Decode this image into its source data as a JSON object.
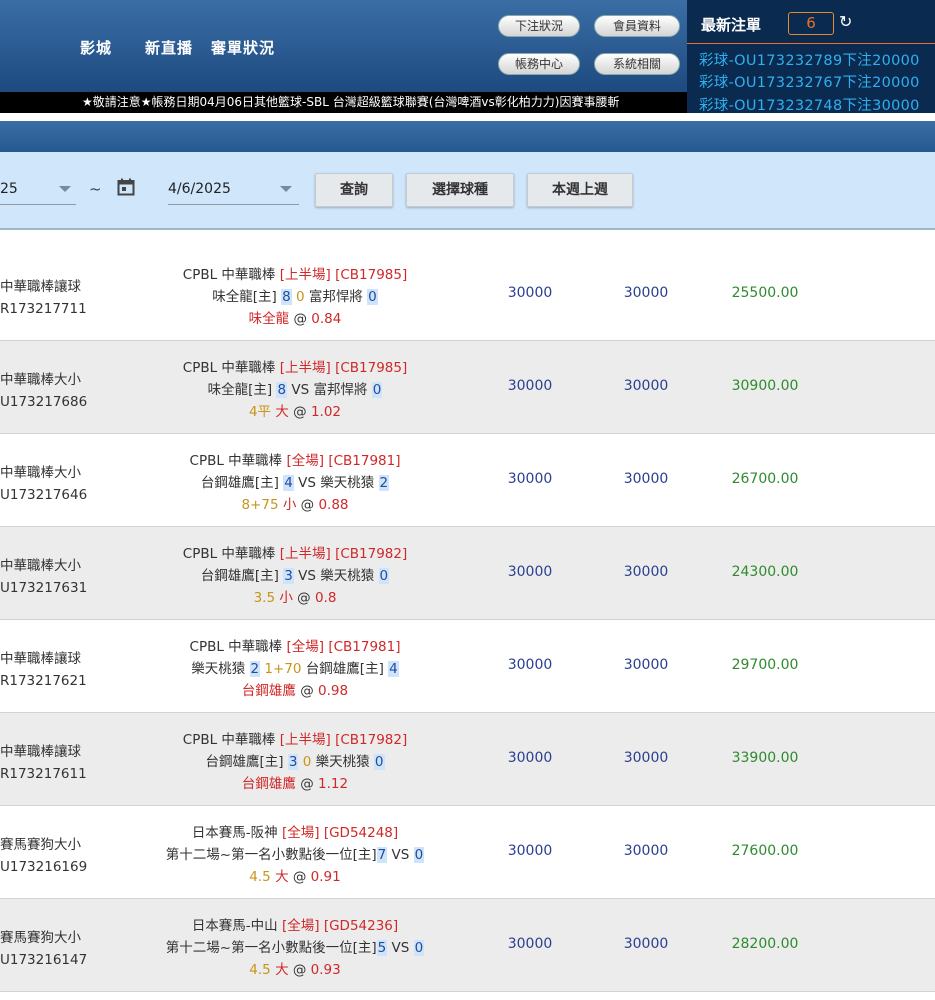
{
  "header": {
    "nav": [
      "影城",
      "新直播",
      "審單狀況"
    ],
    "top_buttons": [
      "下注狀況",
      "會員資料",
      "帳務中心",
      "系統相關"
    ],
    "latest": {
      "title": "最新注單",
      "count": "6",
      "items": [
        "彩球-OU173232789下注20000",
        "彩球-OU173232767下注20000",
        "彩球-OU173232748下注30000"
      ]
    },
    "marquee": "★敬請注意★帳務日期04月06日其他籃球-SBL  台灣超級籃球聯賽(台灣啤酒vs彰化柏力力)因賽事腰斬"
  },
  "filter": {
    "start_date": "25",
    "separator": "~",
    "end_date": "4/6/2025",
    "buttons": [
      "查詢",
      "選擇球種",
      "本週上週"
    ]
  },
  "rows": [
    {
      "cat": "中華職棒讓球",
      "id": "R173217711",
      "l1": {
        "league": "CPBL 中華職棒",
        "period": "[上半場]",
        "code": "[CB17985]"
      },
      "l2": {
        "a": "味全龍[主]",
        "sa": "8",
        "mid": "0",
        "b": "富邦悍將",
        "sb": "0"
      },
      "l3": {
        "pick": "味全龍",
        "at": "@",
        "odds": "0.84"
      },
      "amt1": "30000",
      "amt2": "30000",
      "win": "25500.00"
    },
    {
      "cat": "中華職棒大小",
      "id": "U173217686",
      "l1": {
        "league": "CPBL 中華職棒",
        "period": "[上半場]",
        "code": "[CB17985]"
      },
      "l2": {
        "a": "味全龍[主]",
        "sa": "8",
        "mid": "VS",
        "b": "富邦悍將",
        "sb": "0"
      },
      "l3": {
        "line": "4平",
        "pick": "大",
        "at": "@",
        "odds": "1.02"
      },
      "amt1": "30000",
      "amt2": "30000",
      "win": "30900.00"
    },
    {
      "cat": "中華職棒大小",
      "id": "U173217646",
      "l1": {
        "league": "CPBL 中華職棒",
        "period": "[全場]",
        "code": "[CB17981]"
      },
      "l2": {
        "a": "台鋼雄鷹[主]",
        "sa": "4",
        "mid": "VS",
        "b": "樂天桃猿",
        "sb": "2"
      },
      "l3": {
        "line": "8+75",
        "pick": "小",
        "at": "@",
        "odds": "0.88"
      },
      "amt1": "30000",
      "amt2": "30000",
      "win": "26700.00"
    },
    {
      "cat": "中華職棒大小",
      "id": "U173217631",
      "l1": {
        "league": "CPBL 中華職棒",
        "period": "[上半場]",
        "code": "[CB17982]"
      },
      "l2": {
        "a": "台鋼雄鷹[主]",
        "sa": "3",
        "mid": "VS",
        "b": "樂天桃猿",
        "sb": "0"
      },
      "l3": {
        "line": "3.5",
        "pick": "小",
        "at": "@",
        "odds": "0.8"
      },
      "amt1": "30000",
      "amt2": "30000",
      "win": "24300.00"
    },
    {
      "cat": "中華職棒讓球",
      "id": "R173217621",
      "l1": {
        "league": "CPBL 中華職棒",
        "period": "[全場]",
        "code": "[CB17981]"
      },
      "l2": {
        "a": "樂天桃猿",
        "sa": "2",
        "mid": "1+70",
        "b": "台鋼雄鷹[主]",
        "sb": "4"
      },
      "l3": {
        "pick": "台鋼雄鷹",
        "at": "@",
        "odds": "0.98"
      },
      "amt1": "30000",
      "amt2": "30000",
      "win": "29700.00"
    },
    {
      "cat": "中華職棒讓球",
      "id": "R173217611",
      "l1": {
        "league": "CPBL 中華職棒",
        "period": "[上半場]",
        "code": "[CB17982]"
      },
      "l2": {
        "a": "台鋼雄鷹[主]",
        "sa": "3",
        "mid": "0",
        "b": "樂天桃猿",
        "sb": "0"
      },
      "l3": {
        "pick": "台鋼雄鷹",
        "at": "@",
        "odds": "1.12"
      },
      "amt1": "30000",
      "amt2": "30000",
      "win": "33900.00"
    },
    {
      "cat": "賽馬賽狗大小",
      "id": "U173216169",
      "l1": {
        "league": "日本賽馬-阪神",
        "period": "[全場]",
        "code": "[GD54248]"
      },
      "l2": {
        "a": "第十二場~第一名小數點後一位[主]",
        "sa": "7",
        "mid": "VS",
        "b": "",
        "sb": "0"
      },
      "l3": {
        "line": "4.5",
        "pick": "大",
        "at": "@",
        "odds": "0.91"
      },
      "amt1": "30000",
      "amt2": "30000",
      "win": "27600.00"
    },
    {
      "cat": "賽馬賽狗大小",
      "id": "U173216147",
      "l1": {
        "league": "日本賽馬-中山",
        "period": "[全場]",
        "code": "[GD54236]"
      },
      "l2": {
        "a": "第十二場~第一名小數點後一位[主]",
        "sa": "5",
        "mid": "VS",
        "b": "",
        "sb": "0"
      },
      "l3": {
        "line": "4.5",
        "pick": "大",
        "at": "@",
        "odds": "0.93"
      },
      "amt1": "30000",
      "amt2": "30000",
      "win": "28200.00"
    }
  ]
}
